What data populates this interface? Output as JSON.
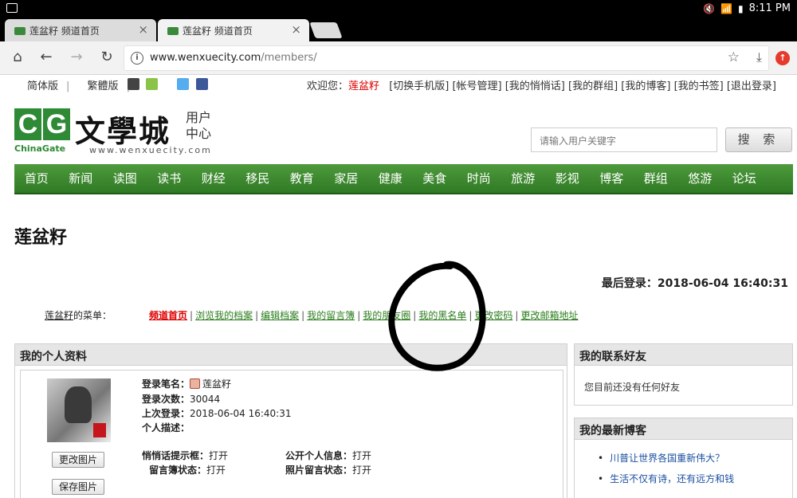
{
  "status": {
    "time": "8:11 PM"
  },
  "tabs": [
    {
      "title": "莲盆籽 频道首页"
    },
    {
      "title": "莲盆籽 频道首页"
    }
  ],
  "omnibar": {
    "host": "www.wenxuecity.com",
    "path": "/members/"
  },
  "topnav": {
    "lang_simplified": "简体版",
    "lang_traditional": "繁體版",
    "welcome_prefix": "欢迎您：",
    "user": "莲盆籽",
    "links": "[切换手机版] [帐号管理] [我的悄悄话] [我的群组] [我的博客] [我的书签] [退出登录]"
  },
  "logo": {
    "cg_letters": [
      "C",
      "G"
    ],
    "brand_en": "ChinaGate",
    "brand_cn": "文學城",
    "url": "www.wenxuecity.com",
    "sub1": "用户",
    "sub2": "中心"
  },
  "search": {
    "placeholder": "请输入用户关键字",
    "button": "搜 索"
  },
  "menu": [
    "首页",
    "新闻",
    "读图",
    "读书",
    "财经",
    "移民",
    "教育",
    "家居",
    "健康",
    "美食",
    "时尚",
    "旅游",
    "影视",
    "博客",
    "群组",
    "悠游",
    "论坛"
  ],
  "page": {
    "name": "莲盆籽",
    "last_login": "最后登录：2018-06-04 16:40:31",
    "menu_owner": "莲盆籽",
    "menu_suffix": "的菜单：",
    "links": [
      "频道首页",
      "浏览我的档案",
      "编辑档案",
      "我的留言簿",
      "我的朋友圈",
      "我的黑名单",
      "更改密码",
      "更改邮箱地址"
    ]
  },
  "profile": {
    "header": "我的个人资料",
    "penname_label": "登录笔名：",
    "penname": "莲盆籽",
    "login_count_label": "登录次数：",
    "login_count": "30044",
    "last_login_label": "上次登录：",
    "last_login": "2018-06-04 16:40:31",
    "desc_label": "个人描述：",
    "whisper_label": "悄悄话提示框：",
    "whisper": "打开",
    "public_label": "公开个人信息：",
    "public": "打开",
    "guestbook_label": "留言簿状态：",
    "guestbook": "打开",
    "photo_msg_label": "照片留言状态：",
    "photo_msg": "打开",
    "change_photo": "更改图片",
    "save_photo": "保存图片"
  },
  "friends": {
    "header": "我的联系好友",
    "empty": "您目前还没有任何好友"
  },
  "blog": {
    "header": "我的最新博客",
    "items": [
      "川普让世界各国重新伟大？",
      "生活不仅有诗，还有远方和钱"
    ]
  },
  "colors": {
    "menu_green": "#3a8a2c",
    "link_green": "#2a7d1b",
    "accent_red": "#d00000"
  }
}
